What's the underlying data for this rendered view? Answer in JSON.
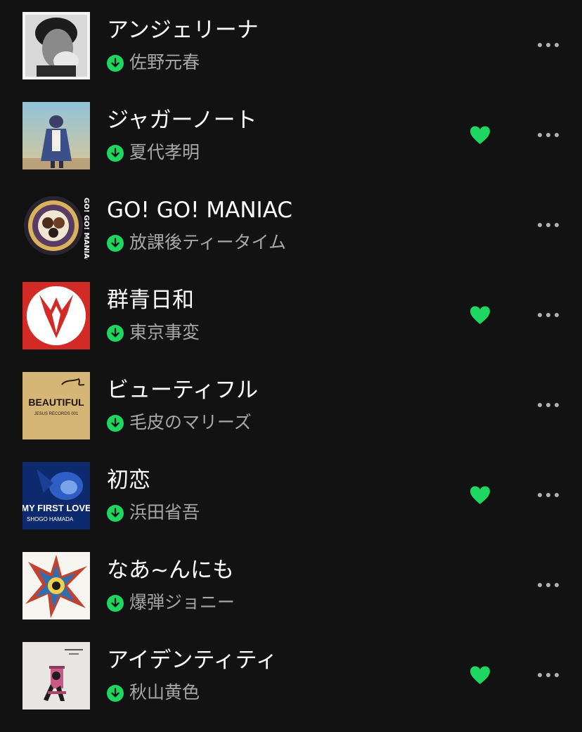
{
  "colors": {
    "background": "#121212",
    "title": "#ffffff",
    "artist": "#a7a7a7",
    "accent": "#1ed760",
    "more": "#b3b3b3"
  },
  "tracks": [
    {
      "title": "アンジェリーナ",
      "artist": "佐野元春",
      "downloaded": true,
      "liked": false,
      "art_text": ""
    },
    {
      "title": "ジャガーノート",
      "artist": "夏代孝明",
      "downloaded": true,
      "liked": true,
      "art_text": ""
    },
    {
      "title": "GO! GO! MANIAC",
      "artist": "放課後ティータイム",
      "downloaded": true,
      "liked": false,
      "art_text": "GO! GO! MANIAC"
    },
    {
      "title": "群青日和",
      "artist": "東京事変",
      "downloaded": true,
      "liked": true,
      "art_text": ""
    },
    {
      "title": "ビューティフル",
      "artist": "毛皮のマリーズ",
      "downloaded": true,
      "liked": false,
      "art_text": "BEAUTIFUL",
      "art_subtext": "JESUS RECORDS 001"
    },
    {
      "title": "初恋",
      "artist": "浜田省吾",
      "downloaded": true,
      "liked": true,
      "art_text": "MY FIRST LOVE",
      "art_subtext": "SHOGO HAMADA"
    },
    {
      "title": "なあ~んにも",
      "artist": "爆弾ジョニー",
      "downloaded": true,
      "liked": false,
      "art_text": ""
    },
    {
      "title": "アイデンティティ",
      "artist": "秋山黄色",
      "downloaded": true,
      "liked": true,
      "art_text": ""
    }
  ],
  "icons": {
    "download": "download-circle-icon",
    "liked": "heart-icon",
    "more": "more-options-icon"
  }
}
